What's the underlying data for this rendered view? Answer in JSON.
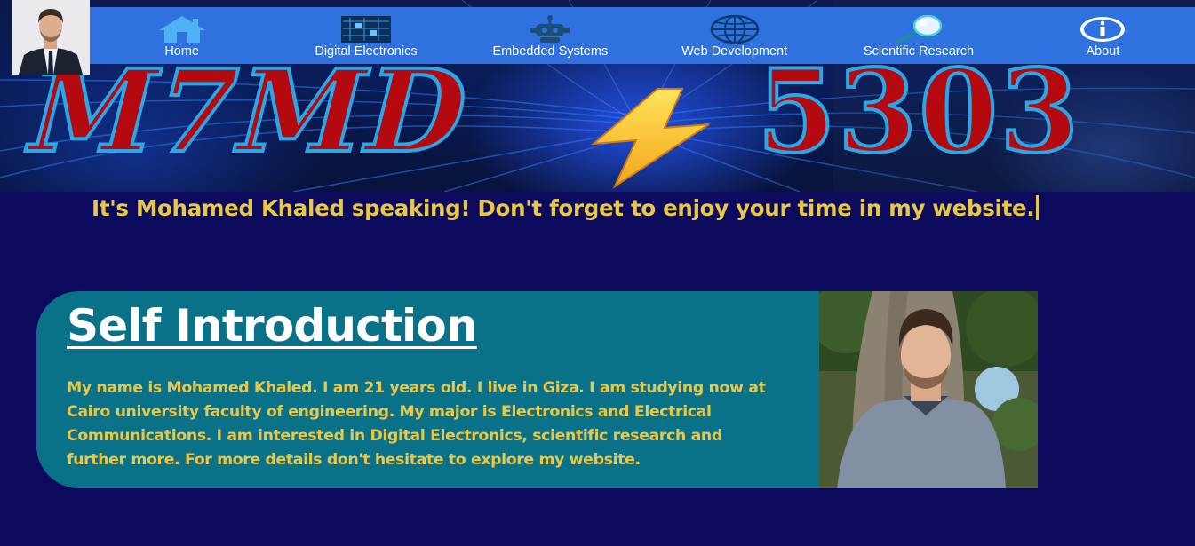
{
  "banner": {
    "left_text": "M7MD",
    "right_text": "5303"
  },
  "nav": {
    "items": [
      {
        "label": "Home",
        "icon": "home-icon"
      },
      {
        "label": "Digital Electronics",
        "icon": "circuit-board-icon"
      },
      {
        "label": "Embedded Systems",
        "icon": "robot-icon"
      },
      {
        "label": "Web Development",
        "icon": "globe-icon"
      },
      {
        "label": "Scientific Research",
        "icon": "magnifier-icon"
      },
      {
        "label": "About",
        "icon": "info-icon"
      }
    ]
  },
  "tagline": "It's Mohamed Khaled speaking! Don't forget to enjoy your time in my website.",
  "intro": {
    "title": "Self Introduction",
    "text": "My name is Mohamed Khaled. I am 21 years old. I live in Giza. I am studying now at Cairo university faculty of engineering. My major is Electronics and Electrical Communications. I am interested in Digital Electronics, scientific research and further more. For more details don't hesitate to explore my website."
  },
  "colors": {
    "page_background": "#0c0a5c",
    "nav_background": "#2f72df",
    "accent_yellow": "#e8c84a",
    "card_teal": "#0a7288",
    "banner_red": "#b3090f",
    "banner_outline": "#2ba7e6"
  }
}
